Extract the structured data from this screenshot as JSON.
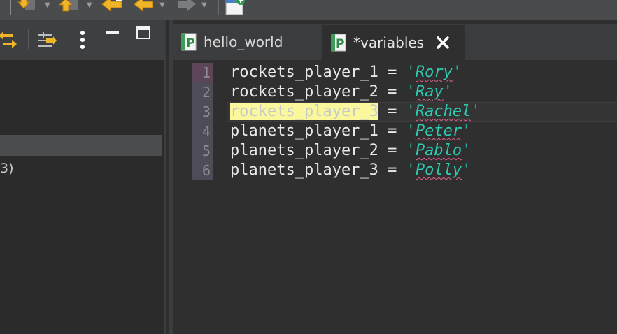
{
  "editor": {
    "tabs": [
      {
        "label": "hello_world",
        "active": false
      },
      {
        "label": "*variables",
        "active": true
      }
    ],
    "line_numbers": [
      "1",
      "2",
      "3",
      "4",
      "5",
      "6"
    ],
    "current_line": 3,
    "lines": [
      {
        "var": "rockets_player_1",
        "op": " = ",
        "q1": "'",
        "value": "Rory",
        "q2": "'"
      },
      {
        "var": "rockets_player_2",
        "op": " = ",
        "q1": "'",
        "value": "Ray",
        "q2": "'"
      },
      {
        "var": "rockets_player_3",
        "op": " = ",
        "q1": "'",
        "value": "Rachel",
        "q2": "'"
      },
      {
        "var": "planets_player_1",
        "op": " = ",
        "q1": "'",
        "value": "Peter",
        "q2": "'"
      },
      {
        "var": "planets_player_2",
        "op": " = ",
        "q1": "'",
        "value": "Pablo",
        "q2": "'"
      },
      {
        "var": "planets_player_3",
        "op": " = ",
        "q1": "'",
        "value": "Polly",
        "q2": "'"
      }
    ]
  },
  "left_view": {
    "tree_fragment": "3)"
  },
  "icons": {
    "python_file": "python-file-icon",
    "close": "close-icon",
    "sync": "link-with-editor-icon",
    "filter": "filter-icon",
    "menu": "view-menu-icon",
    "minimize": "minimize-icon",
    "maximize": "maximize-icon"
  },
  "colors": {
    "string_value": "#2fc9b0",
    "occurrence_highlight": "#faf79d",
    "spell_underline": "#e06090",
    "toolbar_arrow": "#f0b429"
  }
}
